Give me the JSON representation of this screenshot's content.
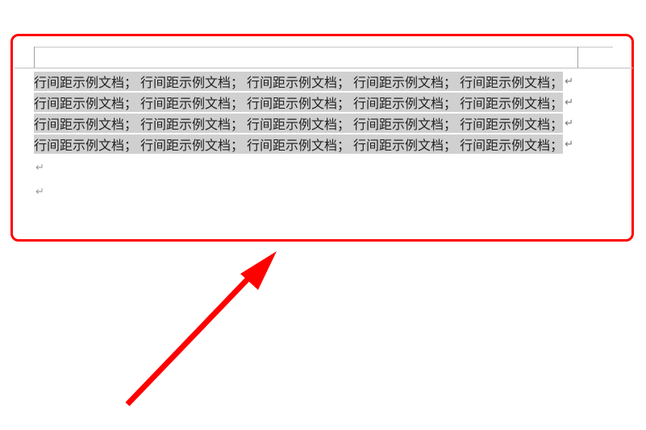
{
  "document": {
    "phrase": "行间距示例文档；",
    "lines": [
      {
        "segments": [
          "行间距示例文档；",
          "行间距示例文档；",
          "行间距示例文档；",
          "行间距示例文档；",
          "行间距示例文档；"
        ]
      },
      {
        "segments": [
          "行间距示例文档；",
          "行间距示例文档；",
          "行间距示例文档；",
          "行间距示例文档；",
          "行间距示例文档；"
        ]
      },
      {
        "segments": [
          "行间距示例文档；",
          "行间距示例文档；",
          "行间距示例文档；",
          "行间距示例文档；",
          "行间距示例文档；"
        ]
      },
      {
        "segments": [
          "行间距示例文档；",
          "行间距示例文档；",
          "行间距示例文档；",
          "行间距示例文档；",
          "行间距示例文档；"
        ]
      }
    ],
    "paragraph_mark": "↵",
    "empty_marks": 2,
    "selected": true
  },
  "annotation": {
    "frame_color": "#ff0000",
    "arrow_color": "#ff0000"
  }
}
